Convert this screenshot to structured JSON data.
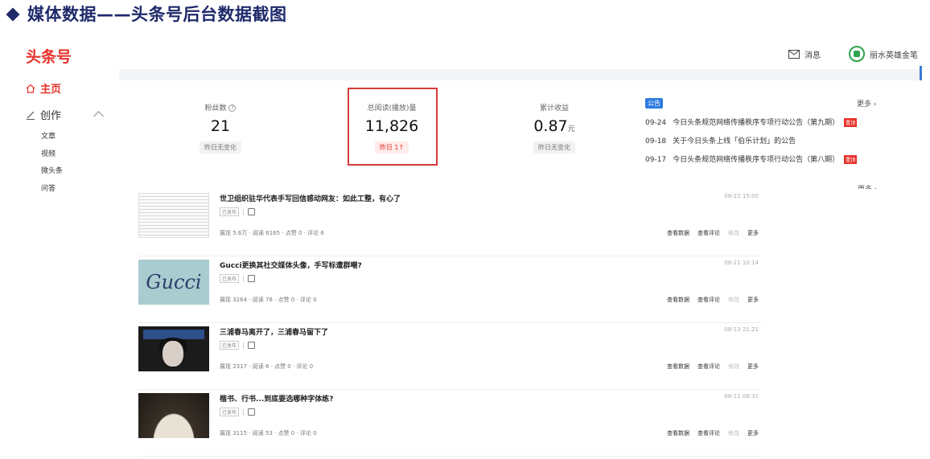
{
  "slide": {
    "title": "媒体数据——头条号后台数据截图"
  },
  "header": {
    "logo": "头条号",
    "messages": "消息",
    "user": "丽水英雄金笔"
  },
  "nav": {
    "home": "主页",
    "create": "创作",
    "sub": [
      "文章",
      "视频",
      "微头条",
      "问答"
    ]
  },
  "stats": {
    "fans": {
      "label": "粉丝数",
      "value": "21",
      "tag": "昨日无变化"
    },
    "reads": {
      "label": "总阅读(播放)量",
      "value": "11,826",
      "tag": "昨日 1↑"
    },
    "income": {
      "label": "累计收益",
      "value": "0.87",
      "unit": "元",
      "tag": "昨日无变化"
    }
  },
  "notice": {
    "badge": "公告",
    "more": "更多",
    "more_cut": "更多",
    "items": [
      {
        "date": "09-24",
        "text": "今日头条规范网络传播秩序专项行动公告（第九期）",
        "hot": "置顶"
      },
      {
        "date": "09-18",
        "text": "关于今日头条上线「伯乐计划」的公告",
        "hot": ""
      },
      {
        "date": "09-17",
        "text": "今日头条规范网络传播秩序专项行动公告（第八期）",
        "hot": "置顶"
      }
    ]
  },
  "articles": [
    {
      "title": "世卫组织驻华代表手写回信感动网友：如此工整，有心了",
      "status": "已发布",
      "metrics": "展现 5.6万 · 阅读 6165 · 点赞 0 · 评论 6",
      "date": "08-22 15:00"
    },
    {
      "title": "Gucci更换其社交媒体头像，手写标遭群嘲?",
      "status": "已发布",
      "metrics": "展现 3264 · 阅读 78 · 点赞 0 · 评论 0",
      "date": "08-21 10:14",
      "thumb_text": "Gucci"
    },
    {
      "title": "三浦春马离开了，三浦春马留下了",
      "status": "已发布",
      "metrics": "展现 2317 · 阅读 6 · 点赞 0 · 评论 0",
      "date": "08-13 21:21"
    },
    {
      "title": "楷书、行书...到底要选哪种字体练?",
      "status": "已发布",
      "metrics": "展现 3115 · 阅读 53 · 点赞 0 · 评论 0",
      "date": "08-11 08:31"
    }
  ],
  "actions": {
    "data": "查看数据",
    "comments": "查看评论",
    "edit": "修改",
    "more": "更多"
  },
  "colors": {
    "brand": "#e8312b",
    "highlight": "#d63a3a",
    "title": "#1f2a6b",
    "notice": "#2d7be0"
  }
}
